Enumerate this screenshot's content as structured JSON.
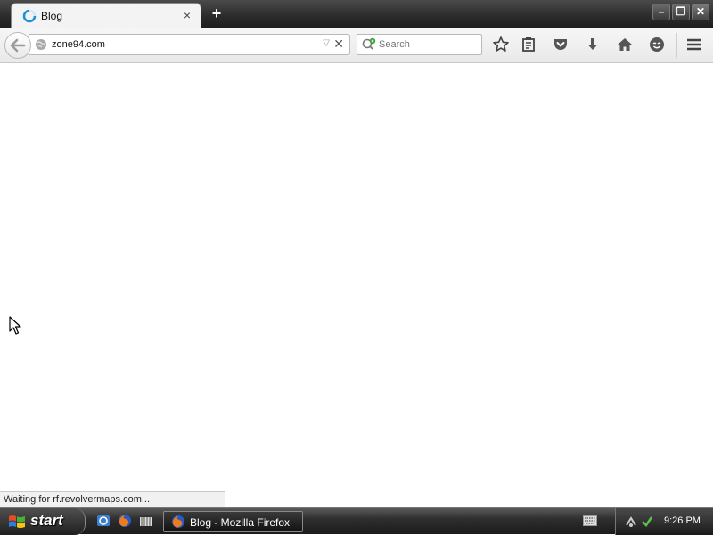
{
  "tab": {
    "title": "Blog",
    "close": "×"
  },
  "newtab": {
    "label": "+"
  },
  "window_controls": {
    "minimize": "–",
    "restore": "❐",
    "close": "✕"
  },
  "urlbar": {
    "value": "zone94.com",
    "stop": "✕"
  },
  "search": {
    "placeholder": "Search"
  },
  "toolbar": {
    "icons": [
      "star-bookmark-icon",
      "reading-list-icon",
      "pocket-icon",
      "download-icon",
      "home-icon",
      "smiley-icon",
      "hamburger-menu-icon"
    ]
  },
  "status": {
    "text": "Waiting for rf.revolvermaps.com..."
  },
  "taskbar": {
    "start_label": "start",
    "task_label": "Blog - Mozilla Firefox",
    "clock": "9:26 PM"
  },
  "colors": {
    "accent": "#1e90d8",
    "taskbar": "#1b1b1b",
    "tabstrip": "#2b2b2b"
  }
}
